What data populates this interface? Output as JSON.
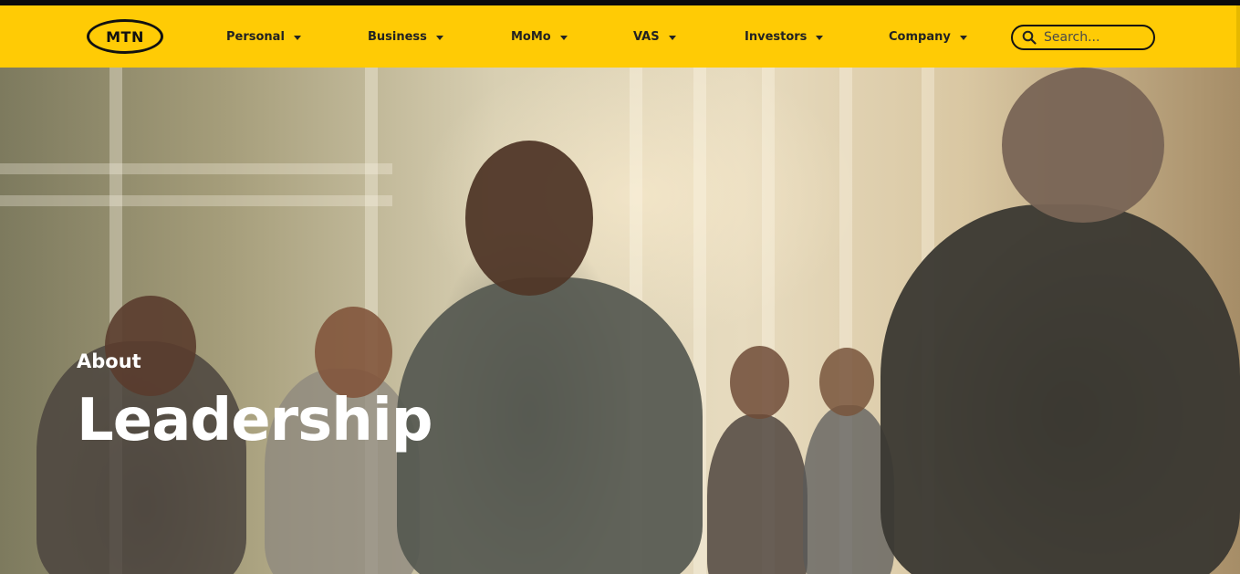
{
  "header": {
    "logo_text": "MTN",
    "nav": [
      {
        "label": "Personal"
      },
      {
        "label": "Business"
      },
      {
        "label": "MoMo"
      },
      {
        "label": "VAS"
      },
      {
        "label": "Investors"
      },
      {
        "label": "Company"
      }
    ],
    "search": {
      "placeholder": "Search..."
    }
  },
  "hero": {
    "kicker": "About",
    "title": "Leadership"
  },
  "colors": {
    "brand_yellow": "#ffcb05",
    "text_dark": "#222222",
    "hero_text": "#ffffff"
  }
}
